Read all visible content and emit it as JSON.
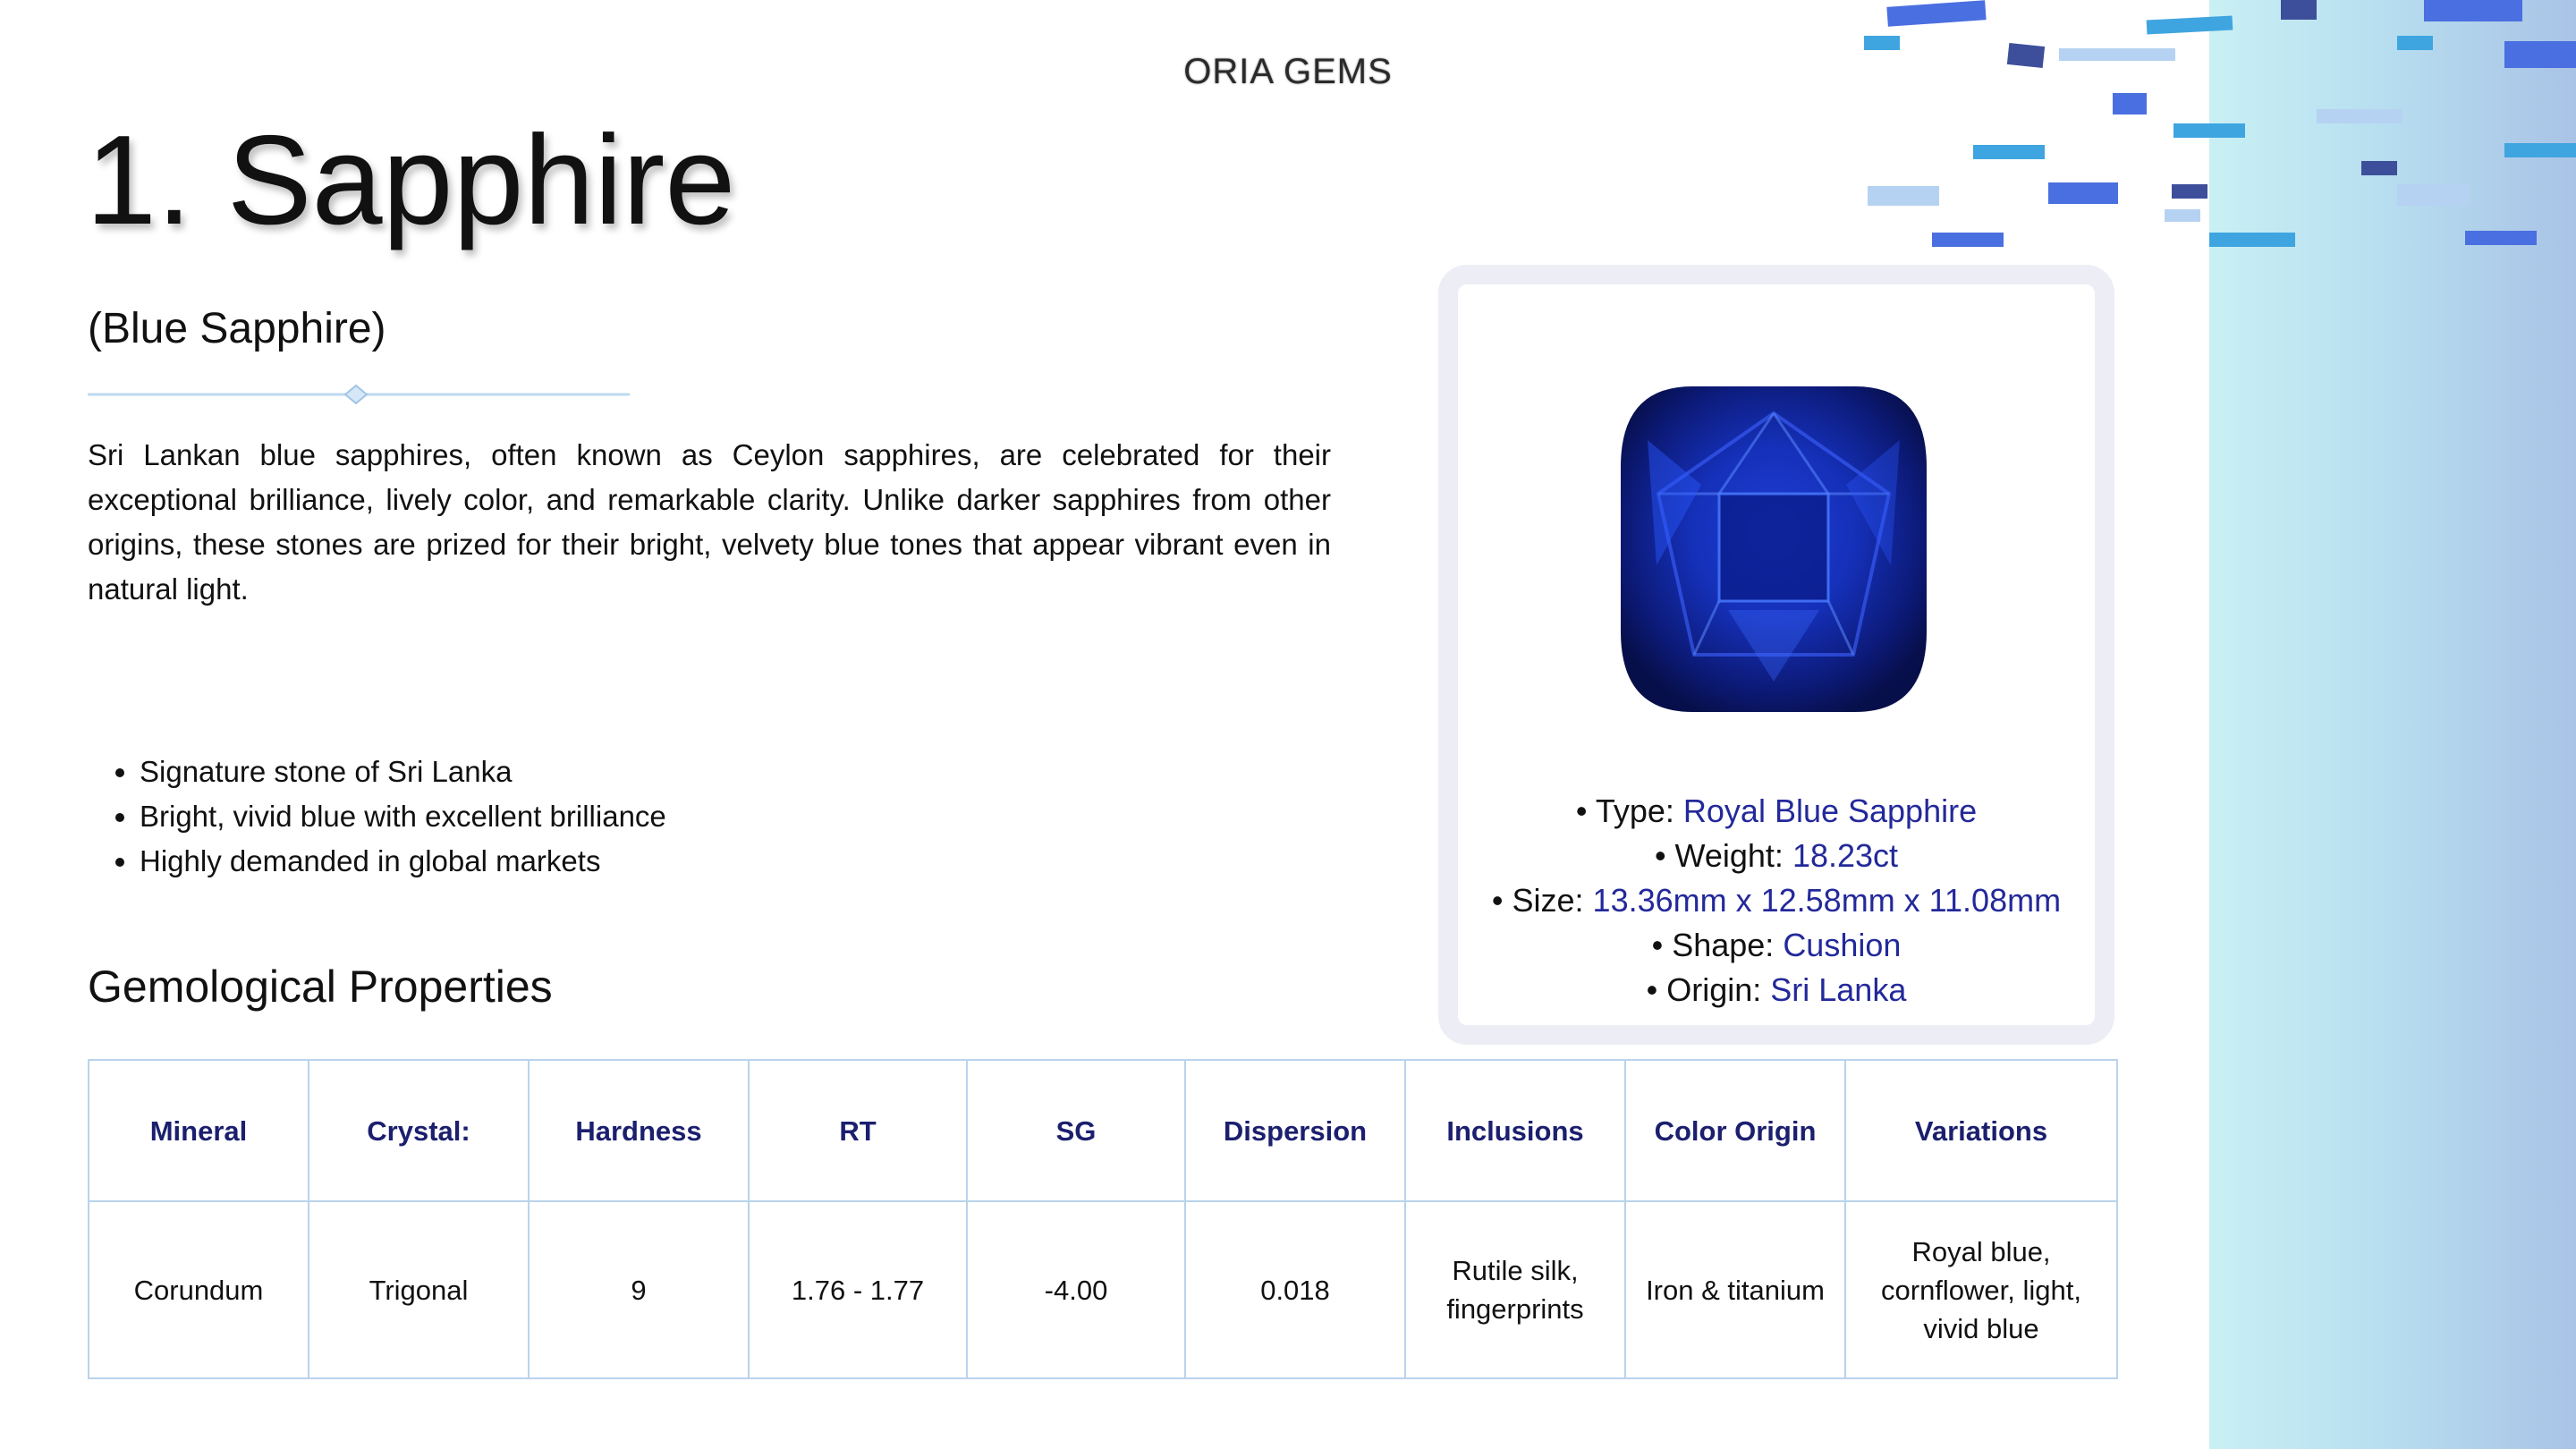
{
  "brand": "ORIA GEMS",
  "title": "1. Sapphire",
  "subtitle": "(Blue Sapphire)",
  "description": "Sri Lankan blue sapphires, often known as Ceylon sapphires, are celebrated for their exceptional brilliance, lively color, and remarkable clarity. Unlike darker sapphires from other origins, these stones are prized for their bright, velvety blue tones that appear vibrant even in natural light.",
  "bullets": [
    "Signature stone of Sri Lanka",
    "Bright, vivid blue with excellent brilliance",
    "Highly demanded in global markets"
  ],
  "section_heading": "Gemological Properties",
  "card": {
    "specs": [
      {
        "label": "• Type: ",
        "value": "Royal Blue Sapphire"
      },
      {
        "label": "• Weight: ",
        "value": "18.23ct"
      },
      {
        "label": "• Size: ",
        "value": "13.36mm x 12.58mm x 11.08mm"
      },
      {
        "label": "• Shape: ",
        "value": "Cushion"
      },
      {
        "label": "• Origin: ",
        "value": "Sri Lanka"
      }
    ]
  },
  "table": {
    "headers": [
      "Mineral",
      "Crystal:",
      "Hardness",
      "RT",
      "SG",
      "Dispersion",
      "Inclusions",
      "Color Origin",
      "Variations"
    ],
    "rows": [
      [
        "Corundum",
        "Trigonal",
        "9",
        "1.76 - 1.77",
        "-4.00",
        "0.018",
        "Rutile silk, fingerprints",
        "Iron & titanium",
        "Royal blue, cornflower, light, vivid blue"
      ]
    ]
  },
  "colors": {
    "accent": "#23299a",
    "header_text": "#1b1f6e",
    "table_border": "#b9d3ec",
    "card_border": "#ecedf5"
  }
}
